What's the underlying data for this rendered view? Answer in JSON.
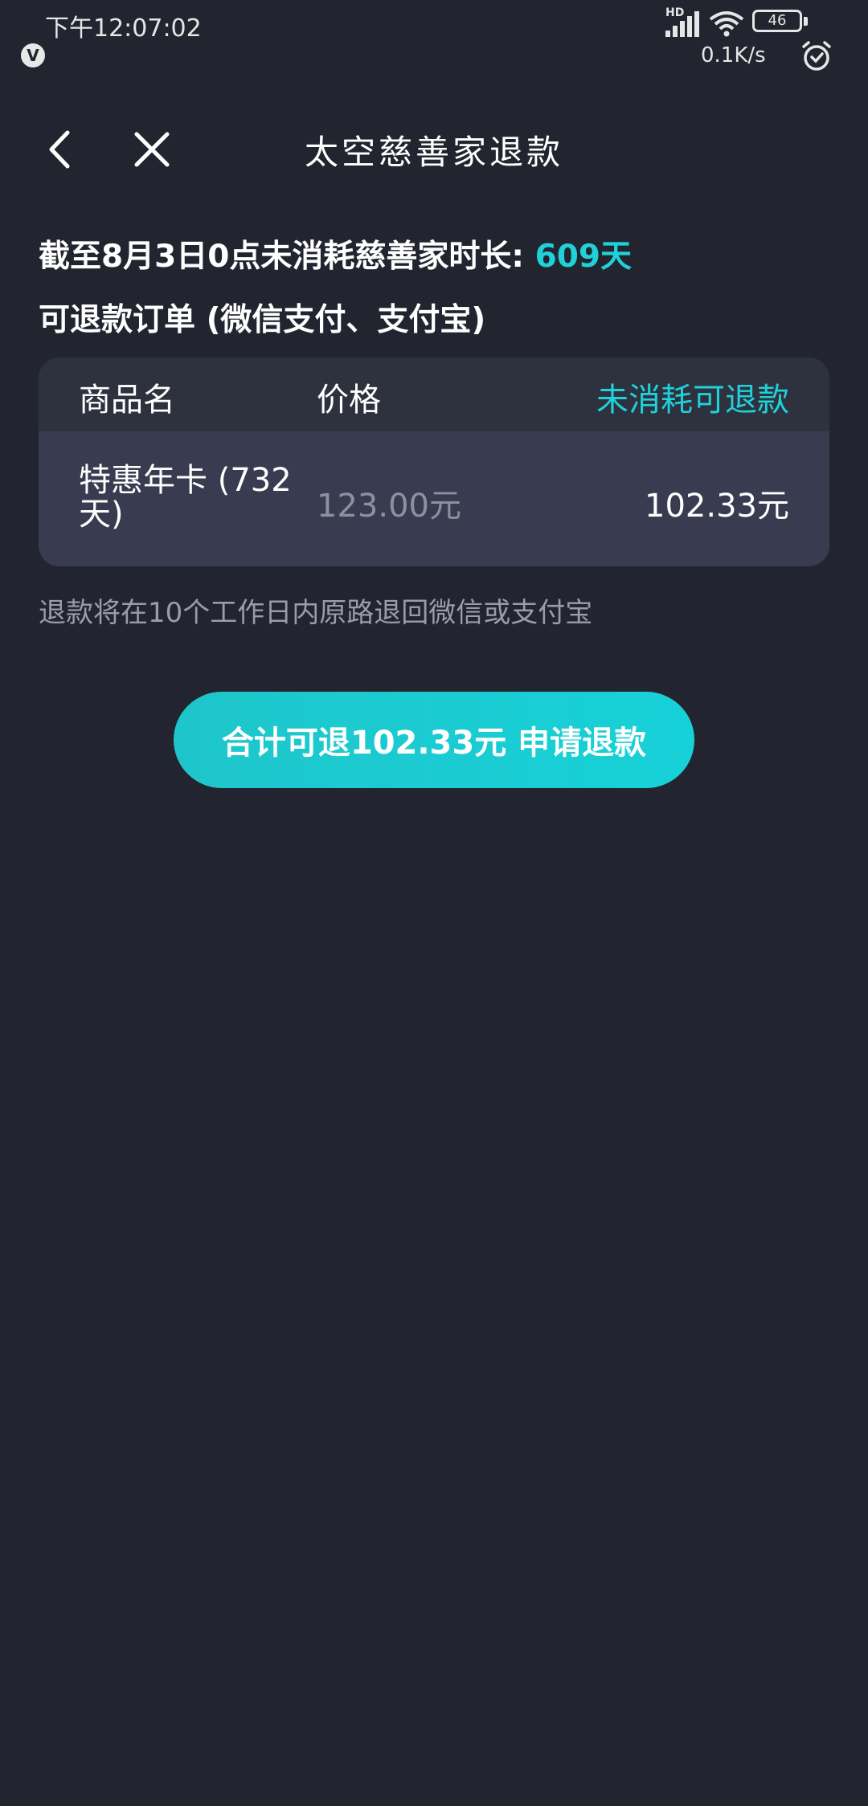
{
  "status_bar": {
    "time": "下午12:07:02",
    "hd": "HD",
    "battery": "46",
    "net_speed": "0.1K/s",
    "carrier_badge": "V"
  },
  "nav": {
    "title": "太空慈善家退款"
  },
  "summary": {
    "prefix": "截至8月3日0点未消耗慈善家时长: ",
    "days": "609天"
  },
  "orders_title": "可退款订单 (微信支付、支付宝)",
  "table": {
    "headers": [
      "商品名",
      "价格",
      "未消耗可退款"
    ],
    "rows": [
      {
        "name": "特惠年卡 (732天)",
        "price": "123.00元",
        "refundable": "102.33元"
      }
    ]
  },
  "refund_note": "退款将在10个工作日内原路退回微信或支付宝",
  "refund_button": "合计可退102.33元 申请退款",
  "colors": {
    "background": "#22252f",
    "accent": "#1fd1d9",
    "table_header": "#2e313e",
    "table_row": "#393c50"
  }
}
